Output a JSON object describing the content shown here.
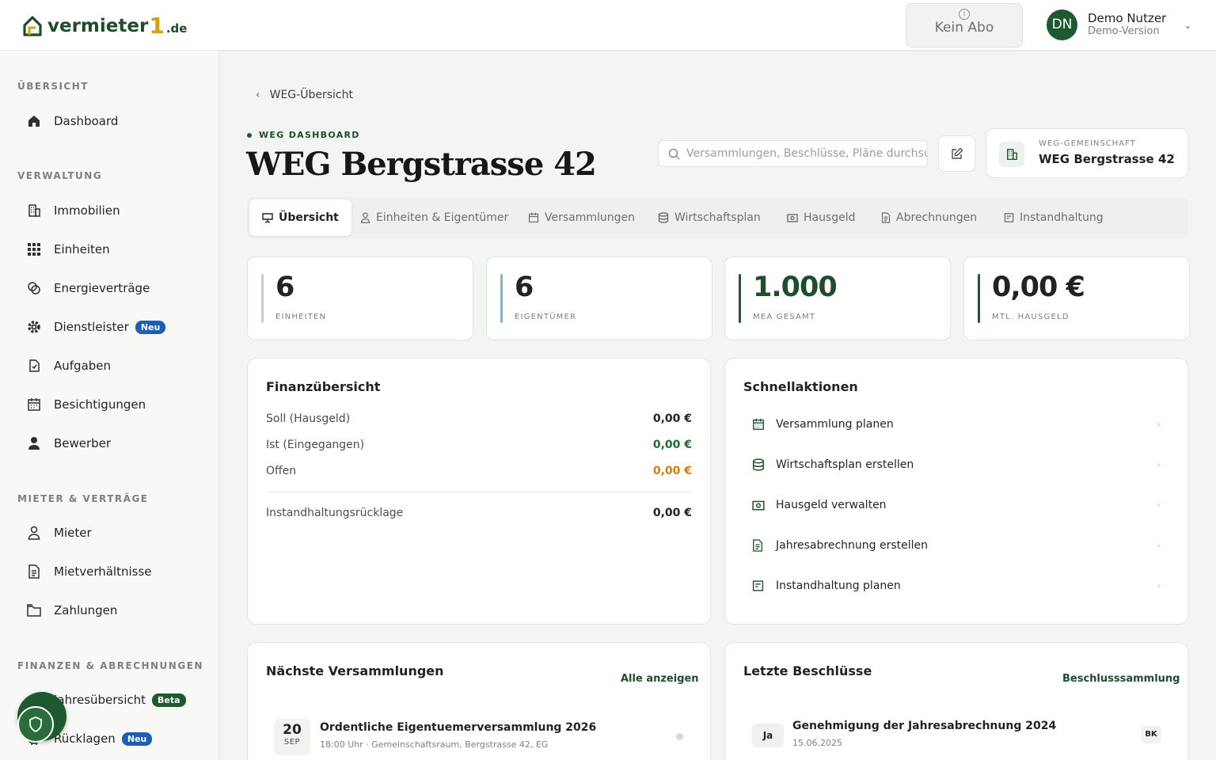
{
  "brand": {
    "name": "vermieter",
    "one": "1",
    "tld": ".de"
  },
  "topbar": {
    "abo_label": "Kein Abo",
    "user_initials": "DN",
    "user_name": "Demo Nutzer",
    "user_sub": "Demo-Version"
  },
  "sidebar": {
    "sections": [
      "ÜBERSICHT",
      "VERWALTUNG",
      "MIETER & VERTRÄGE",
      "FINANZEN & ABRECHNUNGEN"
    ],
    "items": [
      {
        "label": "Dashboard",
        "icon": "home-icon"
      },
      {
        "label": "Immobilien",
        "icon": "building-icon"
      },
      {
        "label": "Einheiten",
        "icon": "grid-icon"
      },
      {
        "label": "Energieverträge",
        "icon": "energy-icon"
      },
      {
        "label": "Dienstleister",
        "icon": "gear-icon",
        "badge": "Neu"
      },
      {
        "label": "Aufgaben",
        "icon": "task-icon"
      },
      {
        "label": "Besichtigungen",
        "icon": "calendar-icon"
      },
      {
        "label": "Bewerber",
        "icon": "person-icon"
      },
      {
        "label": "Mieter",
        "icon": "user-outline-icon"
      },
      {
        "label": "Mietverhältnisse",
        "icon": "document-icon"
      },
      {
        "label": "Zahlungen",
        "icon": "wallet-icon"
      },
      {
        "label": "Jahresübersicht",
        "icon": "chart-icon",
        "badge": "Beta"
      },
      {
        "label": "Rücklagen",
        "icon": "piggy-icon",
        "badge": "Neu"
      }
    ]
  },
  "page": {
    "breadcrumb": "WEG-Übersicht",
    "eyebrow": "WEG DASHBOARD",
    "title": "WEG Bergstrasse 42",
    "search_placeholder": "Versammlungen, Beschlüsse, Pläne durchsuchen...",
    "weg_label": "WEG-GEMEINSCHAFT",
    "weg_value": "WEG Bergstrasse 42"
  },
  "tabs": [
    "Übersicht",
    "Einheiten & Eigentümer",
    "Versammlungen",
    "Wirtschaftsplan",
    "Hausgeld",
    "Abrechnungen",
    "Instandhaltung"
  ],
  "stats": [
    {
      "value": "6",
      "label": "EINHEITEN"
    },
    {
      "value": "6",
      "label": "EIGENTÜMER"
    },
    {
      "value": "1.000",
      "label": "MEA GESAMT"
    },
    {
      "value": "0,00 €",
      "label": "MTL. HAUSGELD"
    }
  ],
  "finance": {
    "title": "Finanzübersicht",
    "rows": [
      {
        "label": "Soll (Hausgeld)",
        "value": "0,00 €"
      },
      {
        "label": "Ist (Eingegangen)",
        "value": "0,00 €"
      },
      {
        "label": "Offen",
        "value": "0,00 €"
      },
      {
        "label": "Instandhaltungsrücklage",
        "value": "0,00 €"
      }
    ]
  },
  "quick": {
    "title": "Schnellaktionen",
    "items": [
      "Versammlung planen",
      "Wirtschaftsplan erstellen",
      "Hausgeld verwalten",
      "Jahresabrechnung erstellen",
      "Instandhaltung planen"
    ]
  },
  "meetings": {
    "title": "Nächste Versammlungen",
    "link": "Alle anzeigen",
    "item": {
      "day": "20",
      "month": "SEP",
      "title": "Ordentliche Eigentuemerversammlung 2026",
      "sub": "18:00 Uhr · Gemeinschaftsraum, Bergstrasse 42, EG"
    }
  },
  "decisions": {
    "title": "Letzte Beschlüsse",
    "link": "Beschlusssammlung",
    "item": {
      "vote": "Ja",
      "title": "Genehmigung der Jahresabrechnung 2024",
      "date": "15.06.2025",
      "tag": "BK"
    }
  },
  "colors": {
    "brand_green": "#1e5a30",
    "accent_gold": "#d4a017",
    "open_orange": "#d97a0c",
    "received_green": "#1e6b34"
  }
}
